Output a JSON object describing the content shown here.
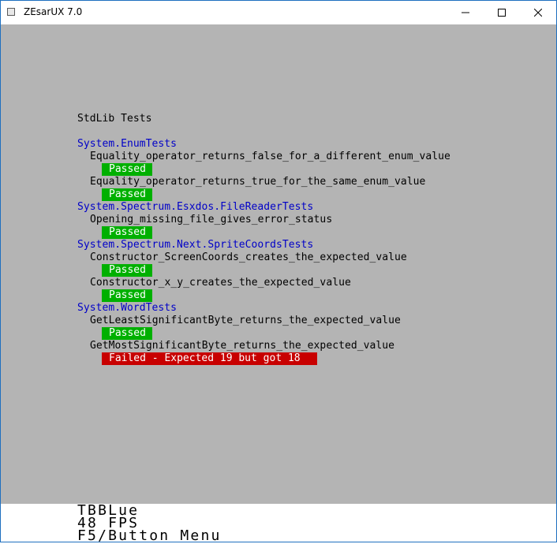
{
  "window": {
    "title": "ZEsarUX 7.0",
    "icons": [
      "app-icon",
      "minimize-icon",
      "maximize-icon",
      "close-icon"
    ]
  },
  "screen": {
    "header": "StdLib Tests",
    "suites": [
      {
        "name": "System.EnumTests",
        "tests": [
          {
            "name": "Equality_operator_returns_false_for_a_different_enum_value",
            "status": "Passed"
          },
          {
            "name": "Equality_operator_returns_true_for_the_same_enum_value",
            "status": "Passed"
          }
        ]
      },
      {
        "name": "System.Spectrum.Esxdos.FileReaderTests",
        "tests": [
          {
            "name": "Opening_missing_file_gives_error_status",
            "status": "Passed"
          }
        ]
      },
      {
        "name": "System.Spectrum.Next.SpriteCoordsTests",
        "tests": [
          {
            "name": "Constructor_ScreenCoords_creates_the_expected_value",
            "status": "Passed"
          },
          {
            "name": "Constructor_x_y_creates_the_expected_value",
            "status": "Passed"
          }
        ]
      },
      {
        "name": "System.WordTests",
        "tests": [
          {
            "name": "GetLeastSignificantByte_returns_the_expected_value",
            "status": "Passed"
          },
          {
            "name": "GetMostSignificantByte_returns_the_expected_value",
            "status": "Failed - Expected 19 but got 18"
          }
        ]
      }
    ],
    "colors": {
      "screen_bg": "#b4b4b4",
      "suite_text": "#0000c8",
      "passed_bg": "#00b000",
      "failed_bg": "#c80000"
    }
  },
  "footer": {
    "machine": "TBBLue",
    "fps": "48 FPS",
    "menu_hint": "F5/Button Menu"
  }
}
